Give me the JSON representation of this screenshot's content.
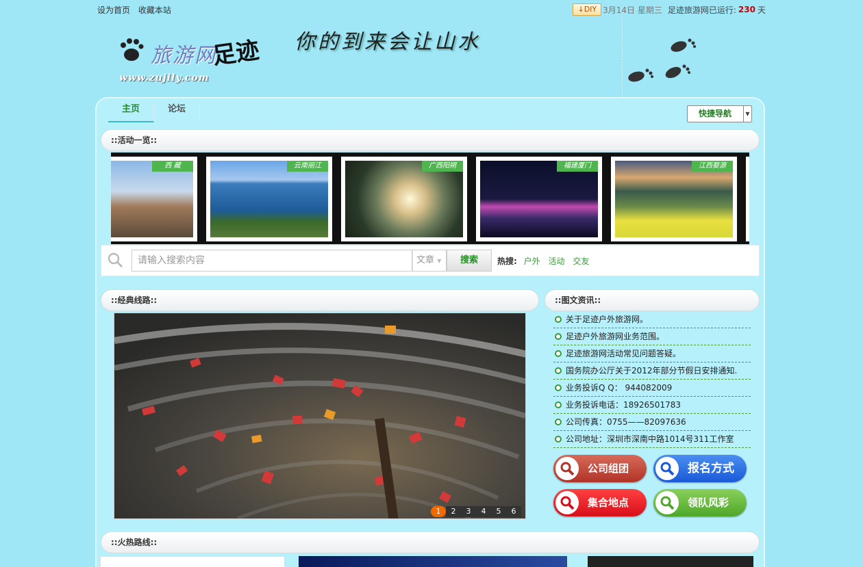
{
  "topbar": {
    "set_home": "设为首页",
    "bookmark": "收藏本站",
    "diy": "DIY",
    "date": "3月14日 星期三",
    "running_label": "足迹旅游网已运行:",
    "running_days": "230",
    "days_unit": "天"
  },
  "header": {
    "logo_name": "旅游网",
    "logo_name2": "足迹",
    "logo_url": "www.zujily.com",
    "slogan": "你的到来会让山水"
  },
  "nav": {
    "tabs": [
      {
        "label": "主页",
        "active": true
      },
      {
        "label": "论坛",
        "active": false
      }
    ],
    "quick_nav": "快捷导航"
  },
  "activities": {
    "title": "::活动一览::",
    "photos": [
      {
        "tag": "西 藏",
        "sky": "#7fb0e0",
        "ground": "#8a6a4a"
      },
      {
        "tag": "云南丽江",
        "sky": "#4f8fd6",
        "ground": "#1f5f9a"
      },
      {
        "tag": "广西阳朔",
        "sky": "#d8c9a0",
        "ground": "#3b4a3a"
      },
      {
        "tag": "福建厦门",
        "sky": "#101838",
        "ground": "#403060"
      },
      {
        "tag": "江西婺源",
        "sky": "#5a6d90",
        "ground": "#e8e04a"
      }
    ]
  },
  "search": {
    "placeholder": "请输入搜索内容",
    "type": "文章",
    "button": "搜索",
    "hot_label": "热搜:",
    "hot_keywords": [
      "户外",
      "活动",
      "交友"
    ]
  },
  "classic": {
    "title": "::经典线路::",
    "pages": [
      "1",
      "2",
      "3",
      "4",
      "5",
      "6"
    ]
  },
  "news": {
    "title": "::图文资讯::",
    "items": [
      "关于足迹户外旅游网。",
      "足迹户外旅游网业务范围。",
      "足迹旅游网活动常见问题答疑。",
      "国务院办公厅关于2012年部分节假日安排通知.",
      "业务投诉Q Q： 944082009",
      "业务投诉电话：18926501783",
      "公司传真：0755——82097636",
      "公司地址：深圳市深南中路1014号311工作室"
    ]
  },
  "buttons": {
    "group": "公司组团",
    "signup": "报名方式",
    "meeting": "集合地点",
    "leader": "领队风彩"
  },
  "hot": {
    "title": "::火热路线::"
  }
}
